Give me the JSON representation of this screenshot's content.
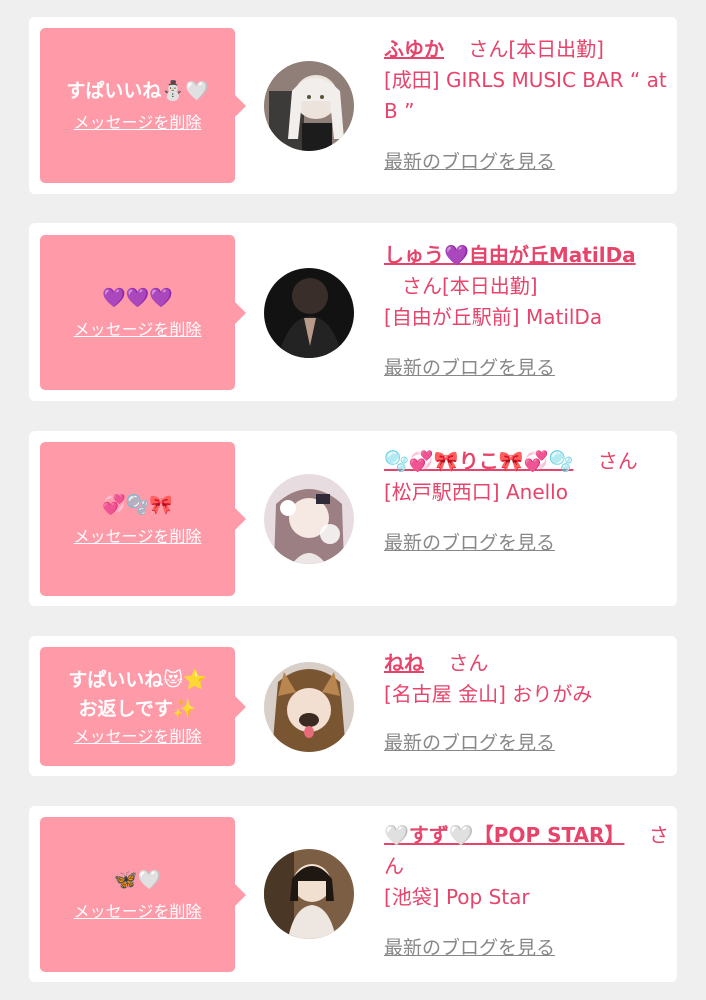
{
  "delete_label": "メッセージを削除",
  "blog_label": "最新のブログを見る",
  "san_label": "さん",
  "status_label": "[本日出勤]",
  "cards": [
    {
      "message": "すぱいいね⛄🤍",
      "name": "ふゆか",
      "shop": "[成田] GIRLS MUSIC BAR “ at B ”"
    },
    {
      "message": "💜💜💜",
      "name": "しゅう💜自由が丘MatilDa",
      "shop": "[自由が丘駅前] MatilDa"
    },
    {
      "message": "💞🫧🎀",
      "name": "🫧💞🎀りこ🎀💞🫧",
      "shop": "[松戸駅西口] Anello"
    },
    {
      "message": "すぱいいね😻⭐\nお返しです✨",
      "name": "ねね",
      "shop": "[名古屋 金山] おりがみ"
    },
    {
      "message": "🦋🤍",
      "name": "🤍すず🤍【POP STAR】",
      "shop": "[池袋] Pop Star"
    }
  ]
}
